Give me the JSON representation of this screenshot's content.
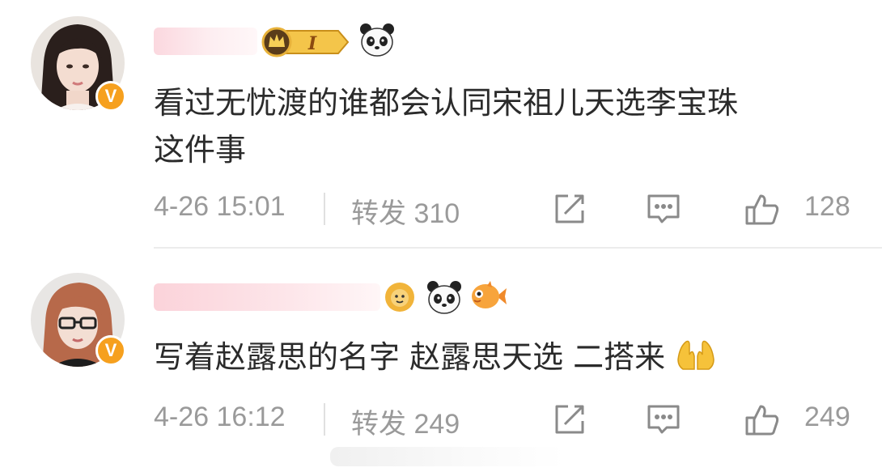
{
  "comments": [
    {
      "text_line1": "看过无忧渡的谁都会认同宋祖儿天选李宝珠",
      "text_line2": "这件事",
      "time": "4-26 15:01",
      "repost": "转发 310",
      "likes": "128",
      "icons": [
        "crown-level-badge-icon",
        "panda-icon",
        "share-icon",
        "comment-icon",
        "like-icon"
      ],
      "badge_level": "I"
    },
    {
      "text": "写着赵露思的名字 赵露思天选 二搭来",
      "time": "4-26 16:12",
      "repost": "转发 249",
      "likes": "249",
      "icons": [
        "lion-icon",
        "panda-icon",
        "fish-icon",
        "praying-hands-icon",
        "share-icon",
        "comment-icon",
        "like-icon"
      ]
    }
  ],
  "colors": {
    "badge": "#f6a01e",
    "meta": "#9a9a9a",
    "text": "#2b2b2b"
  }
}
